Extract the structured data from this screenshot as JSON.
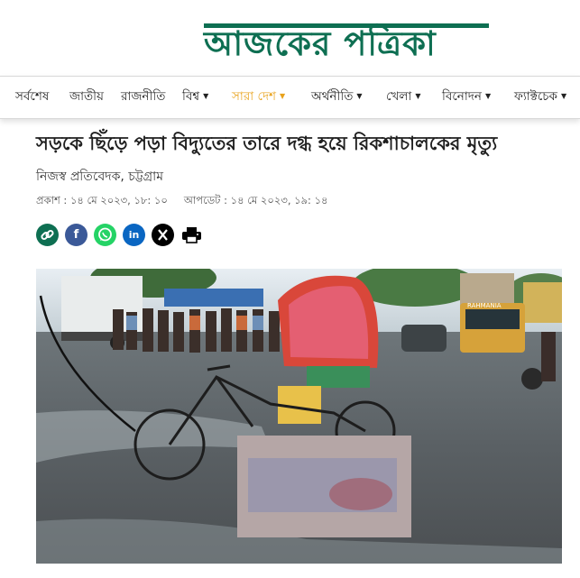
{
  "site": {
    "logo_text": "আজকের পত্রিকা",
    "brand_color": "#0e6f52",
    "accent_color": "#e8a21b"
  },
  "nav": {
    "items": [
      {
        "label": "সর্বশেষ",
        "has_dropdown": false,
        "active": false
      },
      {
        "label": "জাতীয়",
        "has_dropdown": false,
        "active": false
      },
      {
        "label": "রাজনীতি",
        "has_dropdown": false,
        "active": false
      },
      {
        "label": "বিশ্ব",
        "has_dropdown": true,
        "active": false
      },
      {
        "label": "সারা দেশ",
        "has_dropdown": true,
        "active": true
      },
      {
        "label": "অর্থনীতি",
        "has_dropdown": true,
        "active": false
      },
      {
        "label": "খেলা",
        "has_dropdown": true,
        "active": false
      },
      {
        "label": "বিনোদন",
        "has_dropdown": true,
        "active": false
      },
      {
        "label": "ফ্যাক্টচেক",
        "has_dropdown": true,
        "active": false
      }
    ]
  },
  "article": {
    "headline": "সড়কে ছিঁড়ে পড়া বিদ্যুতের তারে দগ্ধ হয়ে রিকশাচালকের মৃত্যু",
    "byline": "নিজস্ব প্রতিবেদক, চট্টগ্রাম",
    "published": "প্রকাশ : ১৪ মে ২০২৩, ১৮: ১০",
    "updated": "আপডেট : ১৪ মে ২০২৩, ১৯: ১৪"
  },
  "share": {
    "buttons": [
      {
        "icon": "link-icon",
        "color": "#0e6f52"
      },
      {
        "icon": "facebook-icon",
        "color": "#3b5998"
      },
      {
        "icon": "whatsapp-icon",
        "color": "#25d366"
      },
      {
        "icon": "linkedin-icon",
        "color": "#0a66c2"
      },
      {
        "icon": "x-icon",
        "color": "#000000"
      },
      {
        "icon": "print-icon",
        "color": "#000000"
      }
    ]
  },
  "photo": {
    "bus_sign": "RAHMANIA"
  }
}
